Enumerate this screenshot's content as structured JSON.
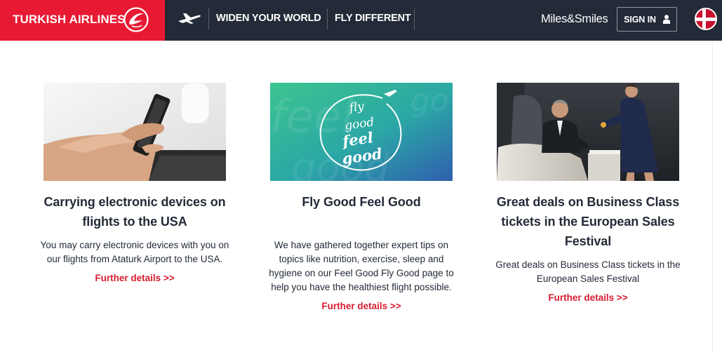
{
  "header": {
    "brand": "TURKISH AIRLINES",
    "nav": [
      "WIDEN YOUR WORLD",
      "FLY DIFFERENT"
    ],
    "miles": "Miles&Smiles",
    "sign_in": "SIGN IN"
  },
  "cards": [
    {
      "title": "Carrying electronic devices on flights to the USA",
      "description": "You may carry electronic devices with you on our flights from Ataturk Airport to the USA.",
      "link": "Further details >>"
    },
    {
      "title": "Fly Good Feel Good",
      "image_text": [
        "fly",
        "good",
        "feel",
        "good"
      ],
      "description": "We have gathered together expert tips on topics like nutrition, exercise, sleep and hygiene on our Feel Good Fly Good page to help you have the healthiest flight possible.",
      "link": "Further details >>"
    },
    {
      "title": "Great deals on Business Class tickets in the European Sales Festival",
      "description": "Great deals on Business Class tickets in the European Sales Festival",
      "link": "Further details >>"
    }
  ],
  "colors": {
    "brand_red": "#e81932",
    "header_navy": "#232b38",
    "link_red": "#d81c31"
  }
}
